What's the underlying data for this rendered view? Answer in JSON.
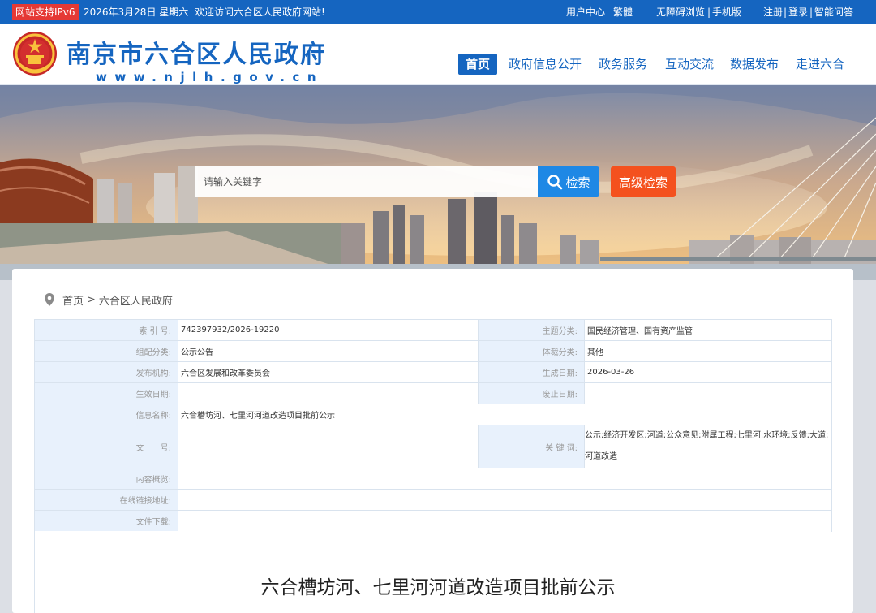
{
  "topbar": {
    "ipv6_badge": "网站支持IPv6",
    "date": "2026年3月28日 星期六",
    "welcome": "欢迎访问六合区人民政府网站!",
    "user_center": "用户中心",
    "traditional": "繁體",
    "accessibility": "无障碍浏览",
    "mobile": "手机版",
    "register": "注册",
    "login": "登录",
    "smart_qa": "智能问答",
    "divider": "|"
  },
  "header": {
    "site_title": "南京市六合区人民政府",
    "site_domain": "www.njlh.gov.cn",
    "nav": [
      {
        "label": "首页",
        "active": true
      },
      {
        "label": "政府信息公开",
        "active": false
      },
      {
        "label": "政务服务",
        "active": false
      },
      {
        "label": "互动交流",
        "active": false
      },
      {
        "label": "数据发布",
        "active": false
      },
      {
        "label": "走进六合",
        "active": false
      }
    ]
  },
  "search": {
    "placeholder": "请输入关键字",
    "button_label": "检索",
    "advanced_label": "高级检索"
  },
  "breadcrumb": {
    "home": "首页",
    "separator": ">",
    "current": "六合区人民政府"
  },
  "meta": {
    "index_label": "索 引 号:",
    "index_value": "742397932/2026-19220",
    "topic_label": "主题分类:",
    "topic_value": "国民经济管理、国有资产监管",
    "category_label": "组配分类:",
    "category_value": "公示公告",
    "genre_label": "体裁分类:",
    "genre_value": "其他",
    "publisher_label": "发布机构:",
    "publisher_value": "六合区发展和改革委员会",
    "created_label": "生成日期:",
    "created_value": "2026-03-26",
    "effective_label": "生效日期:",
    "effective_value": "",
    "expire_label": "废止日期:",
    "expire_value": "",
    "name_label": "信息名称:",
    "name_value": "六合槽坊河、七里河河道改造项目批前公示",
    "docno_label": "文　　号:",
    "docno_value": "",
    "keywords_label": "关 键 词:",
    "keywords_value": "公示;经济开发区;河道;公众意见;附属工程;七里河;水环境;反馈;大道;河道改造",
    "summary_label": "内容概览:",
    "summary_value": "",
    "link_label": "在线链接地址:",
    "link_value": "",
    "download_label": "文件下载:",
    "download_value": ""
  },
  "document": {
    "title": "六合槽坊河、七里河河道改造项目批前公示"
  },
  "colors": {
    "primary_blue": "#1565c0",
    "search_blue": "#1e88e5",
    "advanced_orange": "#f4511e",
    "ipv6_red": "#e53935",
    "label_bg": "#e8f1fc"
  },
  "icons": {
    "emblem": "national-emblem-icon",
    "search": "search-icon",
    "location": "location-pin-icon"
  }
}
